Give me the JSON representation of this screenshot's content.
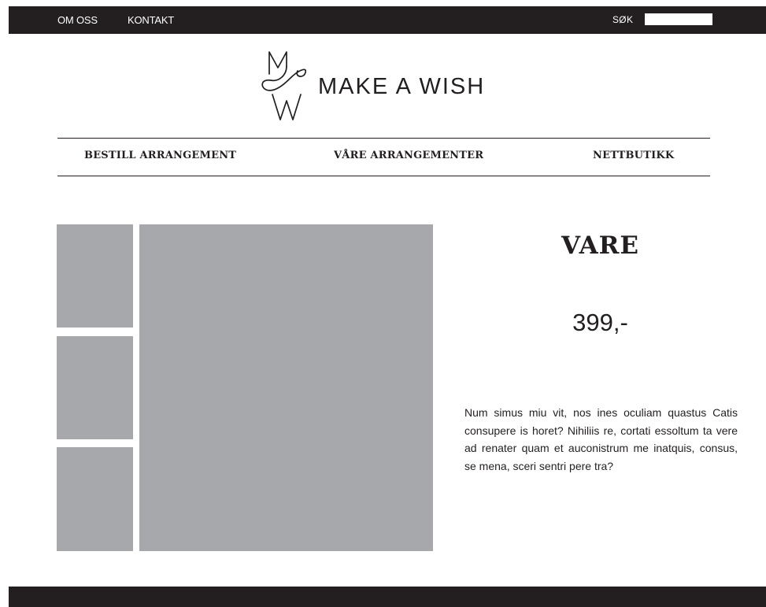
{
  "topbar": {
    "links": [
      "OM OSS",
      "KONTAKT"
    ],
    "search_label": "SØK",
    "search_value": ""
  },
  "logo": {
    "text": "MAKE A WISH",
    "monogram": "MW-monogram-icon"
  },
  "nav": {
    "items": [
      "BESTILL ARRANGEMENT",
      "VÅRE ARRANGEMENTER",
      "NETTBUTIKK"
    ]
  },
  "product": {
    "title": "VARE",
    "price": "399,-",
    "description": "Num simus miu vit, nos ines oculiam quastus Catis consupere is horet? Nihiliis re, cortati essoltum ta vere ad renater quam et auconistrum me inatquis, consus, se mena, sceri sentri pere tra?"
  },
  "colors": {
    "dark": "#231f20",
    "placeholder_gray": "#a7a8ab",
    "background": "#ffffff"
  }
}
